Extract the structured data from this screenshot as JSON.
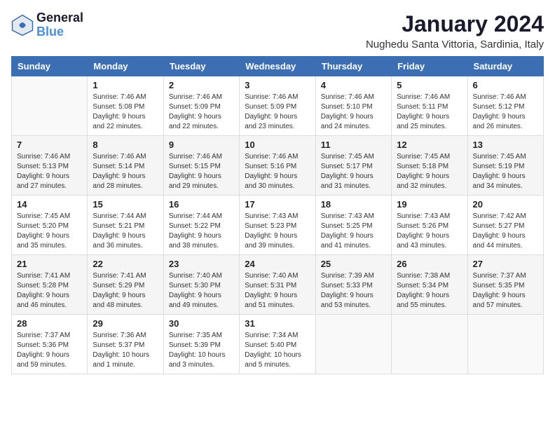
{
  "logo": {
    "line1": "General",
    "line2": "Blue"
  },
  "title": "January 2024",
  "location": "Nughedu Santa Vittoria, Sardinia, Italy",
  "weekdays": [
    "Sunday",
    "Monday",
    "Tuesday",
    "Wednesday",
    "Thursday",
    "Friday",
    "Saturday"
  ],
  "weeks": [
    [
      {
        "day": "",
        "info": ""
      },
      {
        "day": "1",
        "info": "Sunrise: 7:46 AM\nSunset: 5:08 PM\nDaylight: 9 hours\nand 22 minutes."
      },
      {
        "day": "2",
        "info": "Sunrise: 7:46 AM\nSunset: 5:09 PM\nDaylight: 9 hours\nand 22 minutes."
      },
      {
        "day": "3",
        "info": "Sunrise: 7:46 AM\nSunset: 5:09 PM\nDaylight: 9 hours\nand 23 minutes."
      },
      {
        "day": "4",
        "info": "Sunrise: 7:46 AM\nSunset: 5:10 PM\nDaylight: 9 hours\nand 24 minutes."
      },
      {
        "day": "5",
        "info": "Sunrise: 7:46 AM\nSunset: 5:11 PM\nDaylight: 9 hours\nand 25 minutes."
      },
      {
        "day": "6",
        "info": "Sunrise: 7:46 AM\nSunset: 5:12 PM\nDaylight: 9 hours\nand 26 minutes."
      }
    ],
    [
      {
        "day": "7",
        "info": "Sunrise: 7:46 AM\nSunset: 5:13 PM\nDaylight: 9 hours\nand 27 minutes."
      },
      {
        "day": "8",
        "info": "Sunrise: 7:46 AM\nSunset: 5:14 PM\nDaylight: 9 hours\nand 28 minutes."
      },
      {
        "day": "9",
        "info": "Sunrise: 7:46 AM\nSunset: 5:15 PM\nDaylight: 9 hours\nand 29 minutes."
      },
      {
        "day": "10",
        "info": "Sunrise: 7:46 AM\nSunset: 5:16 PM\nDaylight: 9 hours\nand 30 minutes."
      },
      {
        "day": "11",
        "info": "Sunrise: 7:45 AM\nSunset: 5:17 PM\nDaylight: 9 hours\nand 31 minutes."
      },
      {
        "day": "12",
        "info": "Sunrise: 7:45 AM\nSunset: 5:18 PM\nDaylight: 9 hours\nand 32 minutes."
      },
      {
        "day": "13",
        "info": "Sunrise: 7:45 AM\nSunset: 5:19 PM\nDaylight: 9 hours\nand 34 minutes."
      }
    ],
    [
      {
        "day": "14",
        "info": "Sunrise: 7:45 AM\nSunset: 5:20 PM\nDaylight: 9 hours\nand 35 minutes."
      },
      {
        "day": "15",
        "info": "Sunrise: 7:44 AM\nSunset: 5:21 PM\nDaylight: 9 hours\nand 36 minutes."
      },
      {
        "day": "16",
        "info": "Sunrise: 7:44 AM\nSunset: 5:22 PM\nDaylight: 9 hours\nand 38 minutes."
      },
      {
        "day": "17",
        "info": "Sunrise: 7:43 AM\nSunset: 5:23 PM\nDaylight: 9 hours\nand 39 minutes."
      },
      {
        "day": "18",
        "info": "Sunrise: 7:43 AM\nSunset: 5:25 PM\nDaylight: 9 hours\nand 41 minutes."
      },
      {
        "day": "19",
        "info": "Sunrise: 7:43 AM\nSunset: 5:26 PM\nDaylight: 9 hours\nand 43 minutes."
      },
      {
        "day": "20",
        "info": "Sunrise: 7:42 AM\nSunset: 5:27 PM\nDaylight: 9 hours\nand 44 minutes."
      }
    ],
    [
      {
        "day": "21",
        "info": "Sunrise: 7:41 AM\nSunset: 5:28 PM\nDaylight: 9 hours\nand 46 minutes."
      },
      {
        "day": "22",
        "info": "Sunrise: 7:41 AM\nSunset: 5:29 PM\nDaylight: 9 hours\nand 48 minutes."
      },
      {
        "day": "23",
        "info": "Sunrise: 7:40 AM\nSunset: 5:30 PM\nDaylight: 9 hours\nand 49 minutes."
      },
      {
        "day": "24",
        "info": "Sunrise: 7:40 AM\nSunset: 5:31 PM\nDaylight: 9 hours\nand 51 minutes."
      },
      {
        "day": "25",
        "info": "Sunrise: 7:39 AM\nSunset: 5:33 PM\nDaylight: 9 hours\nand 53 minutes."
      },
      {
        "day": "26",
        "info": "Sunrise: 7:38 AM\nSunset: 5:34 PM\nDaylight: 9 hours\nand 55 minutes."
      },
      {
        "day": "27",
        "info": "Sunrise: 7:37 AM\nSunset: 5:35 PM\nDaylight: 9 hours\nand 57 minutes."
      }
    ],
    [
      {
        "day": "28",
        "info": "Sunrise: 7:37 AM\nSunset: 5:36 PM\nDaylight: 9 hours\nand 59 minutes."
      },
      {
        "day": "29",
        "info": "Sunrise: 7:36 AM\nSunset: 5:37 PM\nDaylight: 10 hours\nand 1 minute."
      },
      {
        "day": "30",
        "info": "Sunrise: 7:35 AM\nSunset: 5:39 PM\nDaylight: 10 hours\nand 3 minutes."
      },
      {
        "day": "31",
        "info": "Sunrise: 7:34 AM\nSunset: 5:40 PM\nDaylight: 10 hours\nand 5 minutes."
      },
      {
        "day": "",
        "info": ""
      },
      {
        "day": "",
        "info": ""
      },
      {
        "day": "",
        "info": ""
      }
    ]
  ]
}
